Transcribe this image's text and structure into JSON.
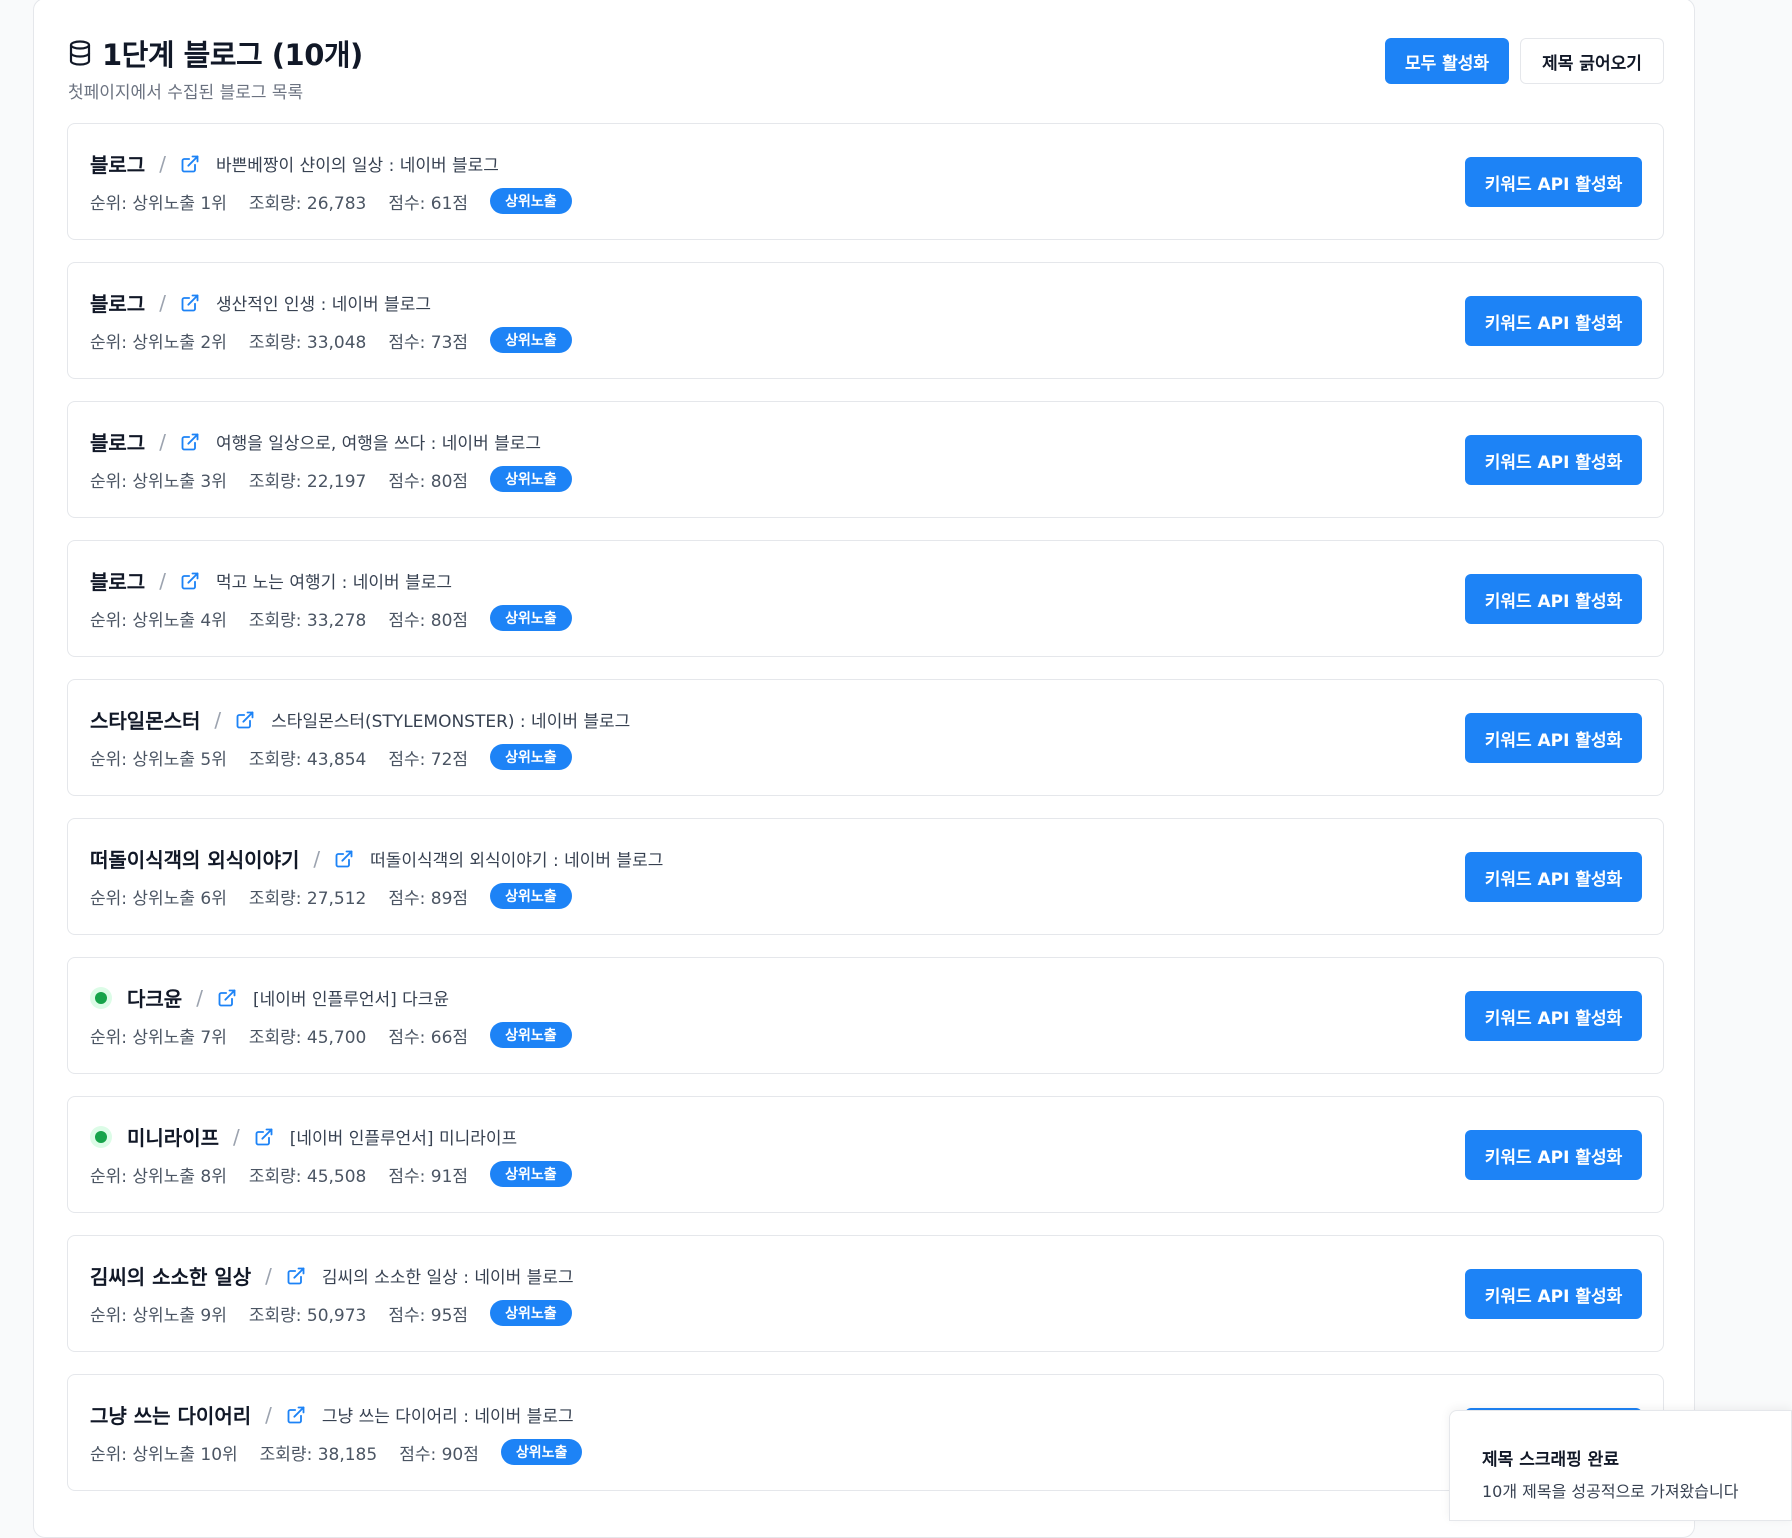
{
  "header": {
    "title": "1단계 블로그 (10개)",
    "subtitle": "첫페이지에서 수집된 블로그 목록",
    "activate_all_label": "모두 활성화",
    "fetch_titles_label": "제목 긁어오기"
  },
  "keyword_button_label": "키워드 API 활성화",
  "blogs": [
    {
      "name": "블로그",
      "title": "바쁜베짱이 샨이의 일상 : 네이버 블로그",
      "rank": "순위: 상위노출 1위",
      "views": "조회량: 26,783",
      "score": "점수: 61점",
      "badge": "상위노출",
      "influencer": false
    },
    {
      "name": "블로그",
      "title": "생산적인 인생 : 네이버 블로그",
      "rank": "순위: 상위노출 2위",
      "views": "조회량: 33,048",
      "score": "점수: 73점",
      "badge": "상위노출",
      "influencer": false
    },
    {
      "name": "블로그",
      "title": "여행을 일상으로, 여행을 쓰다 : 네이버 블로그",
      "rank": "순위: 상위노출 3위",
      "views": "조회량: 22,197",
      "score": "점수: 80점",
      "badge": "상위노출",
      "influencer": false
    },
    {
      "name": "블로그",
      "title": "먹고 노는 여행기 : 네이버 블로그",
      "rank": "순위: 상위노출 4위",
      "views": "조회량: 33,278",
      "score": "점수: 80점",
      "badge": "상위노출",
      "influencer": false
    },
    {
      "name": "스타일몬스터",
      "title": "스타일몬스터(STYLEMONSTER) : 네이버 블로그",
      "rank": "순위: 상위노출 5위",
      "views": "조회량: 43,854",
      "score": "점수: 72점",
      "badge": "상위노출",
      "influencer": false
    },
    {
      "name": "떠돌이식객의 외식이야기",
      "title": "떠돌이식객의 외식이야기 : 네이버 블로그",
      "rank": "순위: 상위노출 6위",
      "views": "조회량: 27,512",
      "score": "점수: 89점",
      "badge": "상위노출",
      "influencer": false
    },
    {
      "name": "다크윤",
      "title": "[네이버 인플루언서] 다크윤",
      "rank": "순위: 상위노출 7위",
      "views": "조회량: 45,700",
      "score": "점수: 66점",
      "badge": "상위노출",
      "influencer": true
    },
    {
      "name": "미니라이프",
      "title": "[네이버 인플루언서] 미니라이프",
      "rank": "순위: 상위노출 8위",
      "views": "조회량: 45,508",
      "score": "점수: 91점",
      "badge": "상위노출",
      "influencer": true
    },
    {
      "name": "김씨의 소소한 일상",
      "title": "김씨의 소소한 일상 : 네이버 블로그",
      "rank": "순위: 상위노출 9위",
      "views": "조회량: 50,973",
      "score": "점수: 95점",
      "badge": "상위노출",
      "influencer": false
    },
    {
      "name": "그냥 쓰는 다이어리",
      "title": "그냥 쓰는 다이어리 : 네이버 블로그",
      "rank": "순위: 상위노출 10위",
      "views": "조회량: 38,185",
      "score": "점수: 90점",
      "badge": "상위노출",
      "influencer": false
    }
  ],
  "toast": {
    "title": "제목 스크래핑 완료",
    "description": "10개 제목을 성공적으로 가져왔습니다"
  },
  "colors": {
    "primary": "#1d83f6",
    "influencer_dot": "#16a34a",
    "border": "#e5e7eb"
  },
  "icons": {
    "title": "database-icon",
    "link": "external-link-icon",
    "influencer": "green-dot-icon"
  }
}
